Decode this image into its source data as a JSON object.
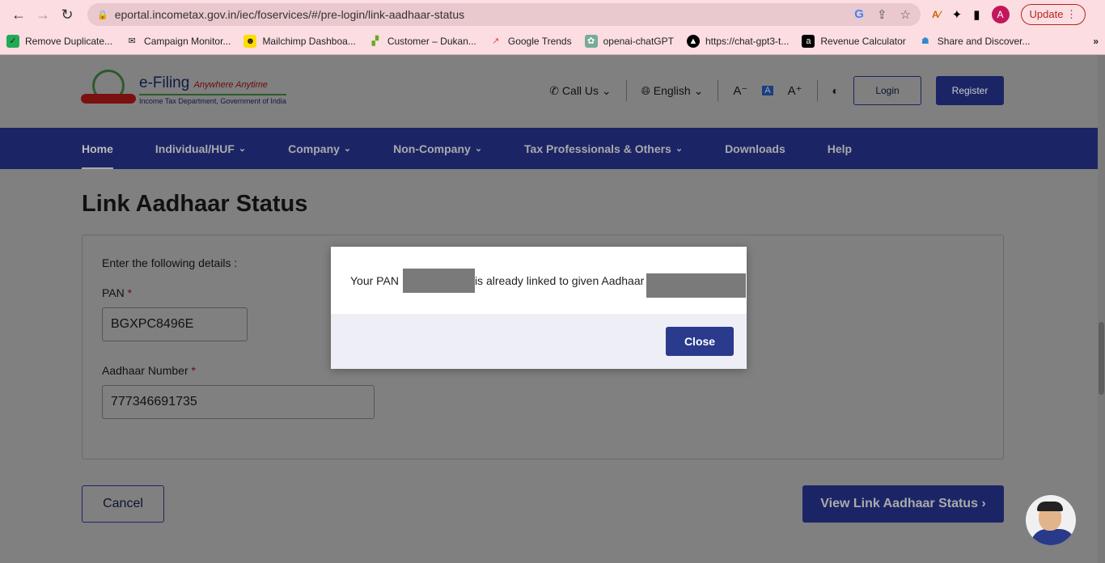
{
  "browser": {
    "url": "eportal.incometax.gov.in/iec/foservices/#/pre-login/link-aadhaar-status",
    "profile_initial": "A",
    "update_label": "Update",
    "bookmarks": [
      "Remove Duplicate...",
      "Campaign Monitor...",
      "Mailchimp Dashboa...",
      "Customer – Dukan...",
      "Google Trends",
      "openai-chatGPT",
      "https://chat-gpt3-t...",
      "Revenue Calculator",
      "Share and Discover..."
    ],
    "more": "»"
  },
  "header": {
    "logo_title": "e-Filing",
    "logo_tagline": "Anywhere Anytime",
    "logo_sub": "Income Tax Department, Government of India",
    "call_us": "Call Us",
    "language": "English",
    "font_decrease": "A⁻",
    "font_normal": "A",
    "font_increase": "A⁺",
    "login": "Login",
    "register": "Register"
  },
  "menu": [
    {
      "label": "Home",
      "dropdown": false
    },
    {
      "label": "Individual/HUF",
      "dropdown": true
    },
    {
      "label": "Company",
      "dropdown": true
    },
    {
      "label": "Non-Company",
      "dropdown": true
    },
    {
      "label": "Tax Professionals & Others",
      "dropdown": true
    },
    {
      "label": "Downloads",
      "dropdown": false
    },
    {
      "label": "Help",
      "dropdown": false
    }
  ],
  "page": {
    "title": "Link Aadhaar Status",
    "instructions": "Enter the following details :",
    "pan_label": "PAN",
    "pan_value": "BGXPC8496E",
    "aadhaar_label": "Aadhaar Number",
    "aadhaar_value": "777346691735",
    "required": "*",
    "cancel": "Cancel",
    "view": "View Link Aadhaar Status ›"
  },
  "modal": {
    "text1": "Your PAN",
    "text2": "is already linked to given Aadhaar",
    "close": "Close"
  }
}
